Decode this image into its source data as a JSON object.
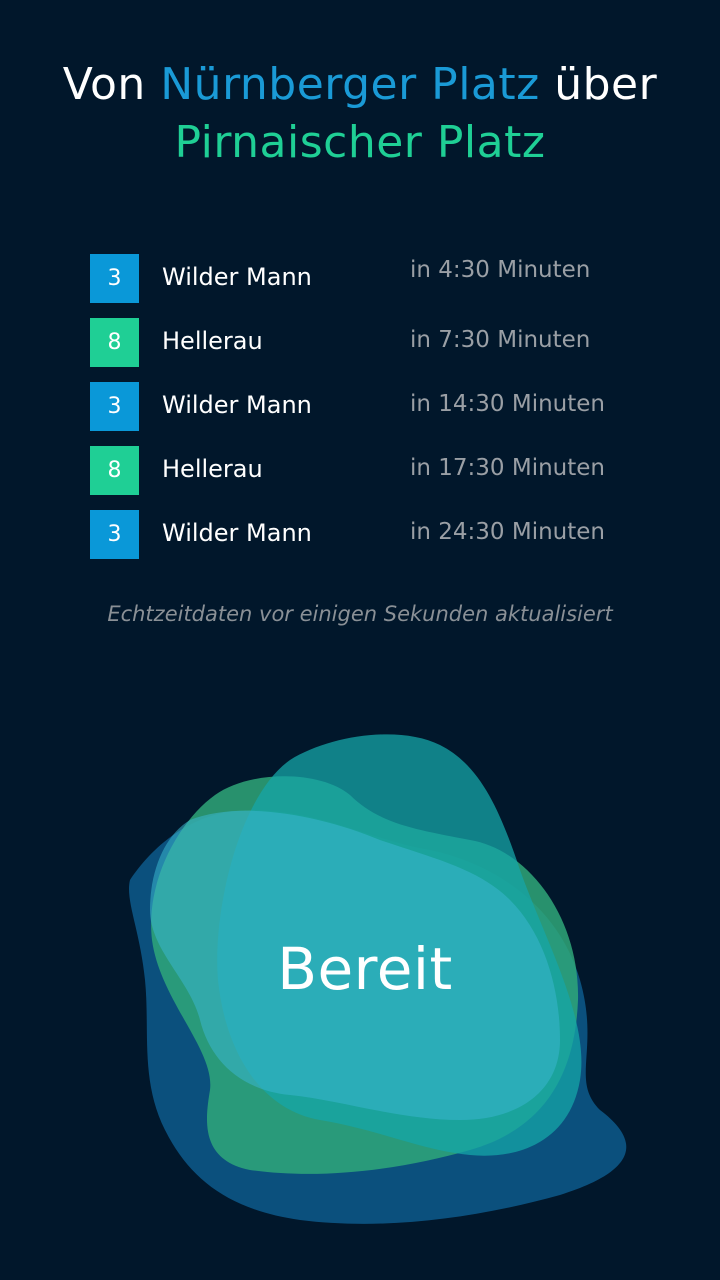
{
  "header": {
    "prefix": "Von",
    "origin": "Nürnberger Platz",
    "middle": "über",
    "via": "Pirnaischer Platz"
  },
  "colors": {
    "background": "#01172b",
    "line_3": "#0a98d8",
    "line_8": "#1fcf95",
    "origin_text": "#1a9ad6",
    "via_text": "#1fcf95"
  },
  "departures": [
    {
      "line": "3",
      "destination": "Wilder Mann",
      "eta": "in 4:30 Minuten",
      "color": "#0a98d8"
    },
    {
      "line": "8",
      "destination": "Hellerau",
      "eta": "in 7:30 Minuten",
      "color": "#1fcf95"
    },
    {
      "line": "3",
      "destination": "Wilder Mann",
      "eta": "in 14:30 Minuten",
      "color": "#0a98d8"
    },
    {
      "line": "8",
      "destination": "Hellerau",
      "eta": "in 17:30 Minuten",
      "color": "#1fcf95"
    },
    {
      "line": "3",
      "destination": "Wilder Mann",
      "eta": "in 24:30 Minuten",
      "color": "#0a98d8"
    }
  ],
  "status_note": "Echtzeitdaten vor einigen Sekunden aktualisiert",
  "voice_button": {
    "label": "Bereit"
  }
}
